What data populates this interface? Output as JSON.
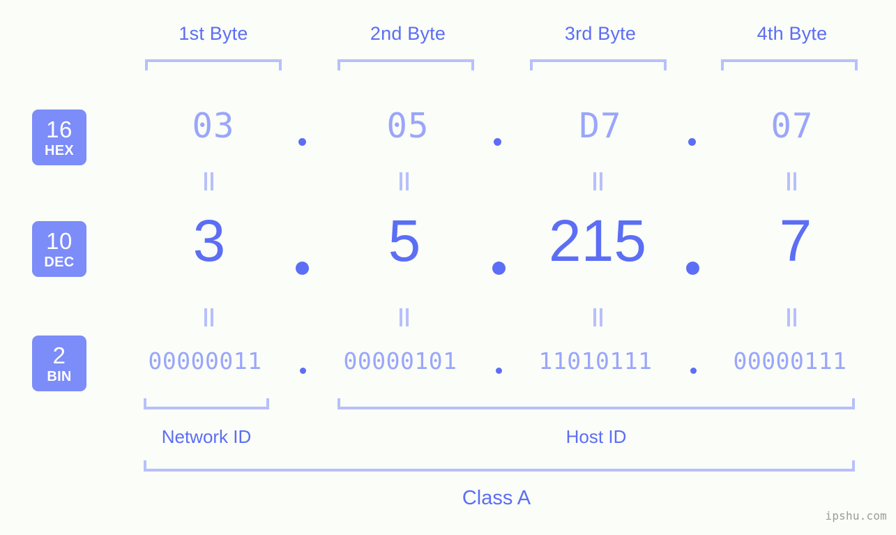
{
  "background_color": "#fbfdf8",
  "accent_color": "#5b6ef5",
  "accent_light_color": "#9aa6fa",
  "bracket_color": "#b7c0fb",
  "badge_color": "#7c8cf8",
  "header": {
    "bytes": [
      {
        "label": "1st Byte"
      },
      {
        "label": "2nd Byte"
      },
      {
        "label": "3rd Byte"
      },
      {
        "label": "4th Byte"
      }
    ]
  },
  "radix_badges": [
    {
      "number": "16",
      "name": "HEX"
    },
    {
      "number": "10",
      "name": "DEC"
    },
    {
      "number": "2",
      "name": "BIN"
    }
  ],
  "rows": {
    "hex": {
      "values": [
        "03",
        "05",
        "D7",
        "07"
      ],
      "separator": "."
    },
    "dec": {
      "values": [
        "3",
        "5",
        "215",
        "7"
      ],
      "separator": "."
    },
    "bin": {
      "values": [
        "00000011",
        "00000101",
        "11010111",
        "00000111"
      ],
      "separator": "."
    }
  },
  "equality_marks": {
    "count_per_gap": 4,
    "symbol": "="
  },
  "sections": [
    {
      "label": "Network ID"
    },
    {
      "label": "Host ID"
    }
  ],
  "class": {
    "label": "Class A"
  },
  "watermark": {
    "text": "ipshu.com"
  },
  "chart_data": {
    "type": "table",
    "title": "IP address 3.5.215.7 byte breakdown",
    "columns": [
      "1st Byte",
      "2nd Byte",
      "3rd Byte",
      "4th Byte"
    ],
    "rows": [
      {
        "radix": "16",
        "name": "HEX",
        "values": [
          "03",
          "05",
          "D7",
          "07"
        ]
      },
      {
        "radix": "10",
        "name": "DEC",
        "values": [
          "3",
          "5",
          "215",
          "7"
        ]
      },
      {
        "radix": "2",
        "name": "BIN",
        "values": [
          "00000011",
          "00000101",
          "11010111",
          "00000111"
        ]
      }
    ],
    "groupings": [
      {
        "label": "Network ID",
        "bytes": [
          1
        ]
      },
      {
        "label": "Host ID",
        "bytes": [
          2,
          3,
          4
        ]
      },
      {
        "label": "Class A",
        "bytes": [
          1,
          2,
          3,
          4
        ]
      }
    ]
  }
}
